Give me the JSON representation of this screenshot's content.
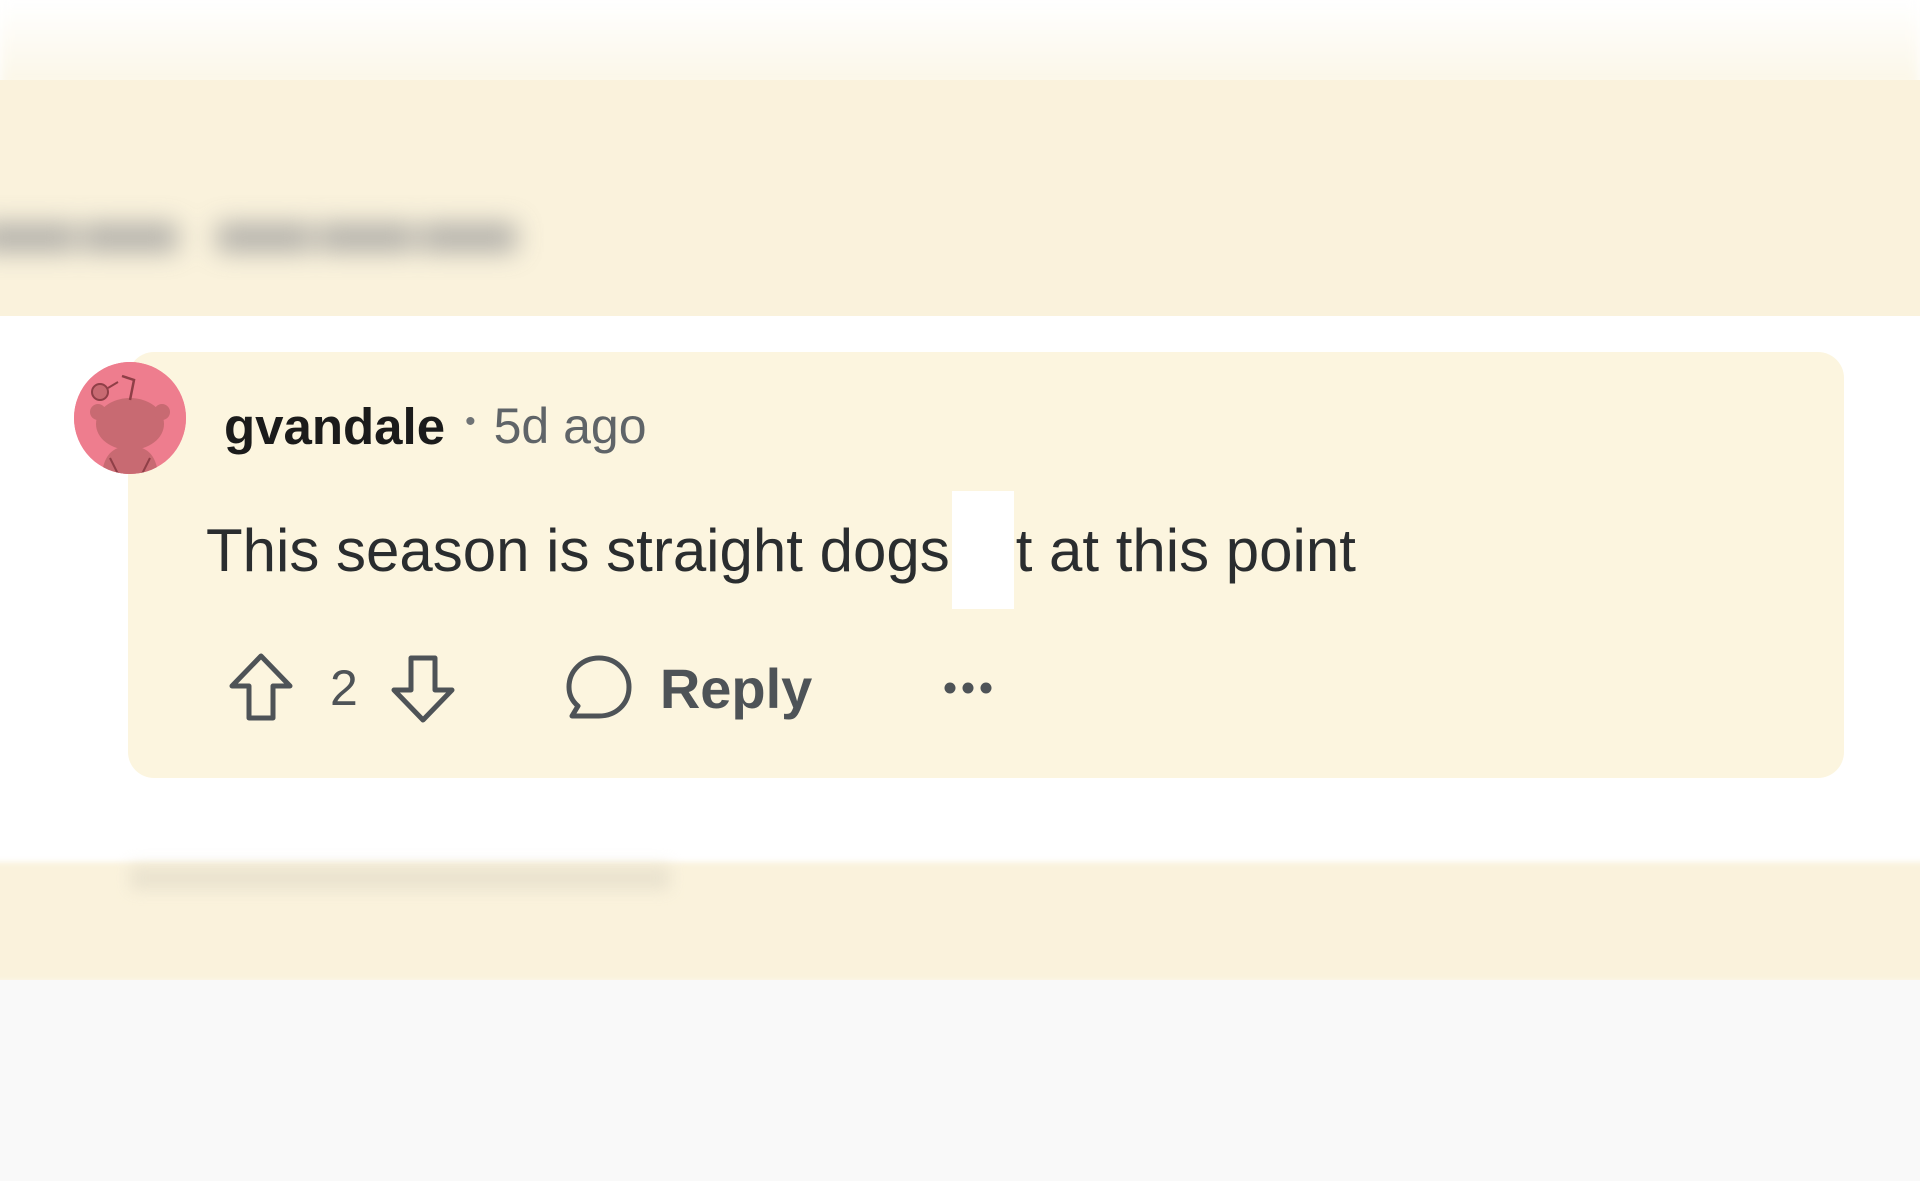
{
  "comment": {
    "username": "gvandale",
    "separator": "•",
    "timestamp": "5d ago",
    "text_before": "This season is straight dogs",
    "text_after": "t at this point",
    "votes": "2",
    "reply_label": "Reply"
  },
  "icons": {
    "avatar": "reddit-snoo-avatar",
    "upvote": "upvote-arrow-icon",
    "downvote": "downvote-arrow-icon",
    "reply": "speech-bubble-icon",
    "more": "ellipsis-icon"
  },
  "colors": {
    "card_background": "#fcf5df",
    "avatar_background": "#ee7d8e",
    "text_primary": "#1b1b1b",
    "text_secondary": "#5f6468",
    "icon_color": "#4e5357"
  }
}
